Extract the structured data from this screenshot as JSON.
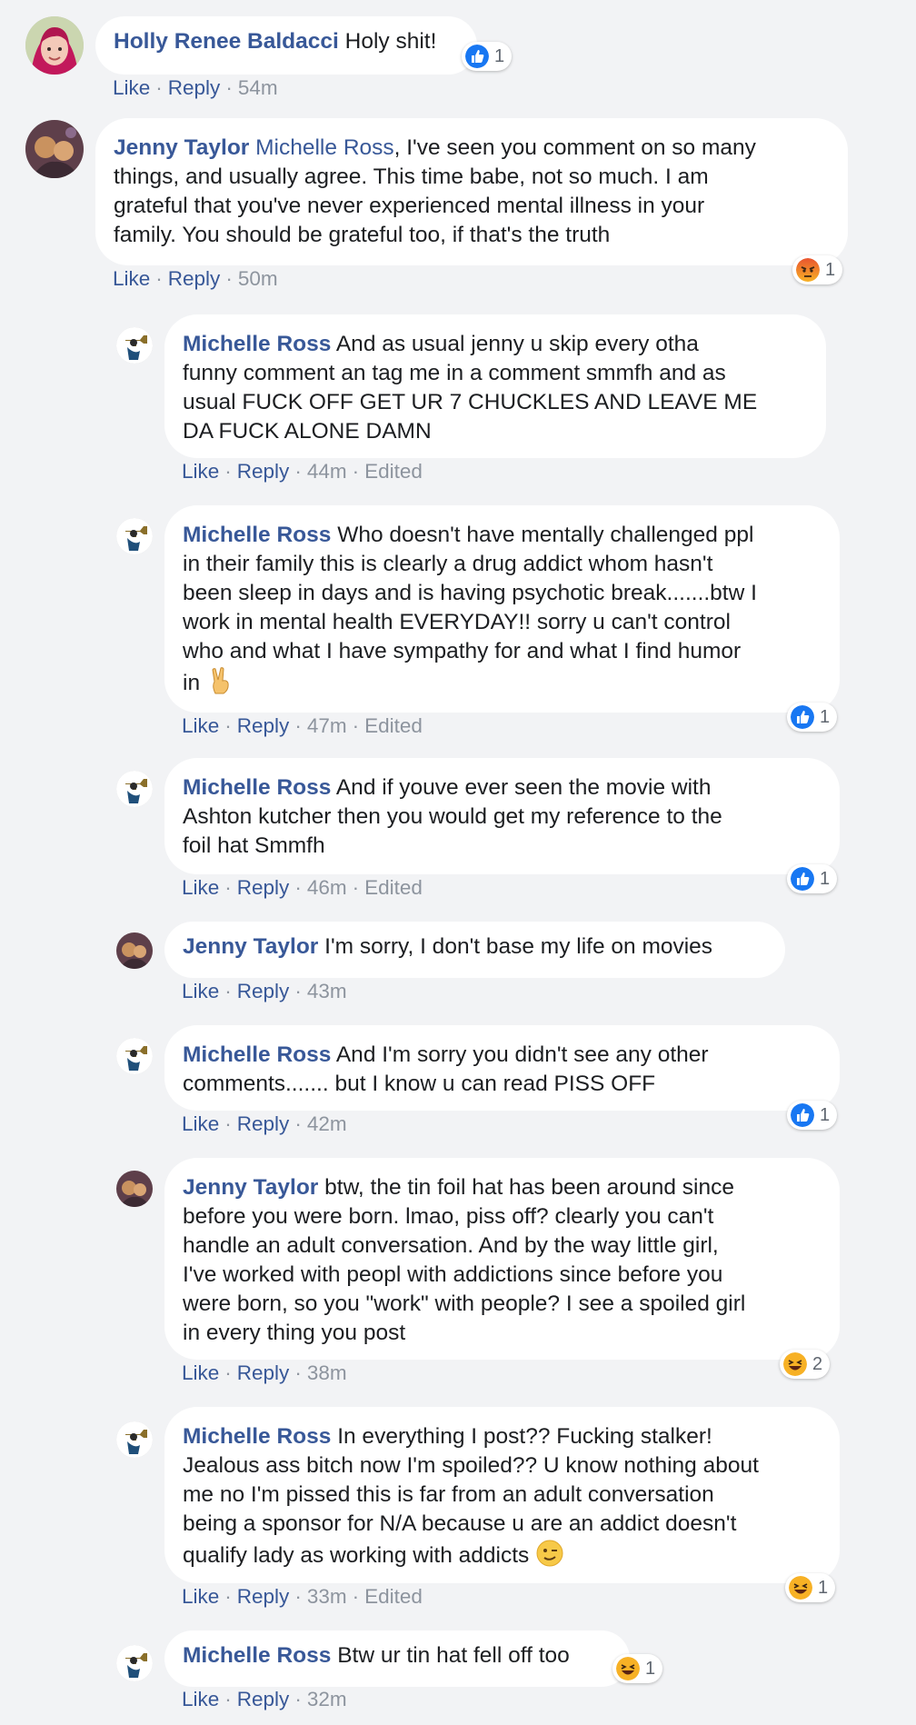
{
  "colors": {
    "background": "#f2f3f5",
    "bubble": "#ffffff",
    "link": "#385898",
    "meta": "#8d949e",
    "like_blue": "#1877f2",
    "angry_red": "#e9542f",
    "haha_yellow": "#f7b125"
  },
  "comments": [
    {
      "author": "Holly Renee Baldacci",
      "text": "Holy shit!",
      "actions": {
        "like": "Like",
        "reply": "Reply",
        "time": "54m"
      },
      "reaction": {
        "icon": "like-icon",
        "count": "1"
      }
    },
    {
      "author": "Jenny Taylor",
      "mention": "Michelle Ross",
      "text_lines": [
        ", I've seen you comment on so many",
        "things, and usually agree. This time babe, not so much. I am",
        "grateful that you've never experienced mental illness in your",
        "family. You should be grateful too, if that's the truth"
      ],
      "actions": {
        "like": "Like",
        "reply": "Reply",
        "time": "50m"
      },
      "reaction": {
        "icon": "angry-icon",
        "count": "1"
      }
    }
  ],
  "replies": [
    {
      "author": "Michelle Ross",
      "text_lines": [
        " And as usual jenny u skip every otha",
        "funny comment an tag me in a comment smmfh and as",
        "usual FUCK OFF GET UR 7 CHUCKLES AND LEAVE ME",
        "DA FUCK ALONE DAMN"
      ],
      "actions": {
        "like": "Like",
        "reply": "Reply",
        "time": "44m",
        "edited": "Edited"
      }
    },
    {
      "author": "Michelle Ross",
      "text_lines": [
        " Who doesn't have mentally challenged ppl",
        "in their family this is clearly a drug addict whom hasn't",
        "been sleep in days and is having psychotic break.......btw I",
        "work in mental health EVERYDAY!! sorry u can't control",
        "who and what I have sympathy for and what I find humor",
        "in"
      ],
      "emoji": "victory-hand-emoji",
      "actions": {
        "like": "Like",
        "reply": "Reply",
        "time": "47m",
        "edited": "Edited"
      },
      "reaction": {
        "icon": "like-icon",
        "count": "1"
      }
    },
    {
      "author": "Michelle Ross",
      "text_lines": [
        " And if youve ever seen the movie with",
        "Ashton kutcher then you would get my reference to the",
        "foil hat Smmfh"
      ],
      "actions": {
        "like": "Like",
        "reply": "Reply",
        "time": "46m",
        "edited": "Edited"
      },
      "reaction": {
        "icon": "like-icon",
        "count": "1"
      }
    },
    {
      "author": "Jenny Taylor",
      "text_lines": [
        " I'm sorry, I don't base my life on movies"
      ],
      "actions": {
        "like": "Like",
        "reply": "Reply",
        "time": "43m"
      }
    },
    {
      "author": "Michelle Ross",
      "text_lines": [
        " And I'm sorry you didn't see any other",
        "comments....... but I know u can read PISS OFF"
      ],
      "actions": {
        "like": "Like",
        "reply": "Reply",
        "time": "42m"
      },
      "reaction": {
        "icon": "like-icon",
        "count": "1"
      }
    },
    {
      "author": "Jenny Taylor",
      "text_lines": [
        " btw, the tin foil hat has been around since",
        "before you were born. lmao, piss off? clearly you can't",
        "handle an adult conversation. And by the way little girl,",
        "I've worked with peopl with addictions since before you",
        "were born, so you \"work\" with people? I see a spoiled girl",
        "in every thing you post"
      ],
      "actions": {
        "like": "Like",
        "reply": "Reply",
        "time": "38m"
      },
      "reaction": {
        "icon": "haha-icon",
        "count": "2"
      }
    },
    {
      "author": "Michelle Ross",
      "text_lines": [
        " In everything I post?? Fucking stalker!",
        "Jealous ass bitch now I'm spoiled?? U know nothing about",
        "me no I'm pissed this is far from an adult conversation",
        "being a sponsor for N/A because u are an addict doesn't",
        "qualify lady as working with addicts"
      ],
      "emoji": "winking-face-emoji",
      "actions": {
        "like": "Like",
        "reply": "Reply",
        "time": "33m",
        "edited": "Edited"
      },
      "reaction": {
        "icon": "haha-icon",
        "count": "1"
      }
    },
    {
      "author": "Michelle Ross",
      "text_lines": [
        " Btw ur tin hat fell off too"
      ],
      "actions": {
        "like": "Like",
        "reply": "Reply",
        "time": "32m"
      },
      "reaction": {
        "icon": "haha-icon",
        "count": "1"
      }
    }
  ]
}
